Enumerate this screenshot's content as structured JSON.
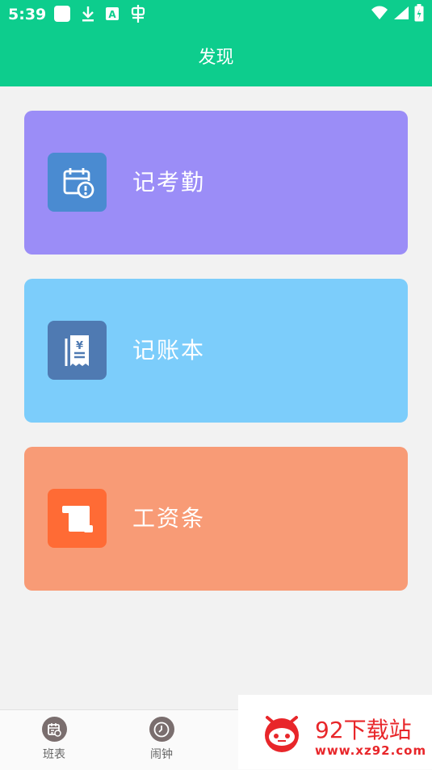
{
  "status_bar": {
    "time": "5:39",
    "left_icons": [
      "app-square-icon",
      "download-icon",
      "a-badge-icon",
      "bug-icon"
    ],
    "right_icons": [
      "wifi-icon",
      "signal-icon",
      "battery-icon"
    ]
  },
  "header": {
    "title": "发现"
  },
  "cards": [
    {
      "label": "记考勤",
      "icon": "attendance-calendar-icon",
      "bg_color": "#9b8df7",
      "icon_bg": "#4a8bd1"
    },
    {
      "label": "记账本",
      "icon": "ledger-receipt-icon",
      "bg_color": "#7ccdfb",
      "icon_bg": "#4f7ab2"
    },
    {
      "label": "工资条",
      "icon": "payslip-scroll-icon",
      "bg_color": "#f89b76",
      "icon_bg": "#ff6b35"
    }
  ],
  "bottom_nav": [
    {
      "label": "班表",
      "icon": "schedule-icon"
    },
    {
      "label": "闹钟",
      "icon": "alarm-clock-icon"
    }
  ],
  "watermark": {
    "title": "92下载站",
    "url": "www.xz92.com"
  }
}
